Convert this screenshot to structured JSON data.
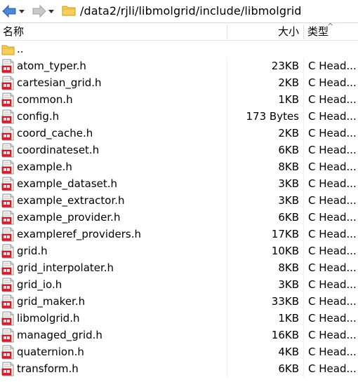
{
  "address": {
    "path": "/data2/rjli/libmolgrid/include/libmolgrid",
    "back_icon": "back-arrow-icon",
    "forward_icon": "forward-arrow-icon"
  },
  "columns": {
    "name": "名称",
    "size": "大小",
    "type": "类型",
    "sort_indicator": "^"
  },
  "parent": {
    "name": ".."
  },
  "files": [
    {
      "name": "atom_typer.h",
      "size": "23KB",
      "type": "C Head..."
    },
    {
      "name": "cartesian_grid.h",
      "size": "2KB",
      "type": "C Head..."
    },
    {
      "name": "common.h",
      "size": "1KB",
      "type": "C Head..."
    },
    {
      "name": "config.h",
      "size": "173 Bytes",
      "type": "C Head..."
    },
    {
      "name": "coord_cache.h",
      "size": "2KB",
      "type": "C Head..."
    },
    {
      "name": "coordinateset.h",
      "size": "6KB",
      "type": "C Head..."
    },
    {
      "name": "example.h",
      "size": "8KB",
      "type": "C Head..."
    },
    {
      "name": "example_dataset.h",
      "size": "3KB",
      "type": "C Head..."
    },
    {
      "name": "example_extractor.h",
      "size": "3KB",
      "type": "C Head..."
    },
    {
      "name": "example_provider.h",
      "size": "6KB",
      "type": "C Head..."
    },
    {
      "name": "exampleref_providers.h",
      "size": "17KB",
      "type": "C Head..."
    },
    {
      "name": "grid.h",
      "size": "10KB",
      "type": "C Head..."
    },
    {
      "name": "grid_interpolater.h",
      "size": "8KB",
      "type": "C Head..."
    },
    {
      "name": "grid_io.h",
      "size": "3KB",
      "type": "C Head..."
    },
    {
      "name": "grid_maker.h",
      "size": "33KB",
      "type": "C Head..."
    },
    {
      "name": "libmolgrid.h",
      "size": "1KB",
      "type": "C Head..."
    },
    {
      "name": "managed_grid.h",
      "size": "16KB",
      "type": "C Head..."
    },
    {
      "name": "quaternion.h",
      "size": "4KB",
      "type": "C Head..."
    },
    {
      "name": "transform.h",
      "size": "6KB",
      "type": "C Head..."
    }
  ],
  "colors": {
    "folder": "#f2c94c",
    "file_icon_red": "#d9262b",
    "nav_blue": "#3d74c8"
  }
}
